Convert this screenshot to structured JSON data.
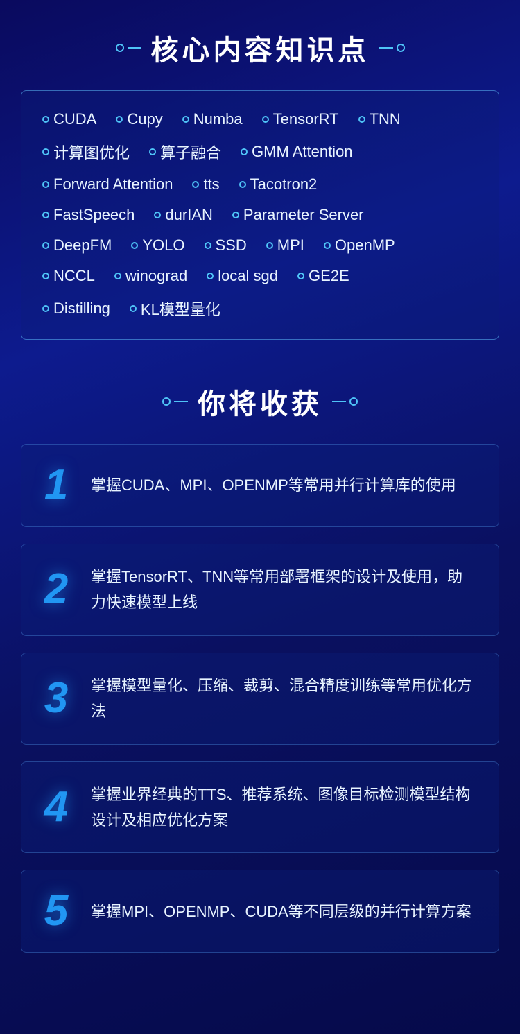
{
  "section1": {
    "title": "核心内容知识点",
    "keywords_rows": [
      [
        "CUDA",
        "Cupy",
        "Numba",
        "TensorRT",
        "TNN"
      ],
      [
        "计算图优化",
        "算子融合",
        "GMM Attention"
      ],
      [
        "Forward Attention",
        "tts",
        "Tacotron2"
      ],
      [
        "FastSpeech",
        "durIAN",
        "Parameter Server"
      ],
      [
        "DeepFM",
        "YOLO",
        "SSD",
        "MPI",
        "OpenMP"
      ],
      [
        "NCCL",
        "winograd",
        "local sgd",
        "GE2E"
      ],
      [
        "Distilling",
        "KL模型量化"
      ]
    ]
  },
  "section2": {
    "title": "你将收获",
    "benefits": [
      {
        "number": "1",
        "text": "掌握CUDA、MPI、OPENMP等常用并行计算库的使用"
      },
      {
        "number": "2",
        "text": "掌握TensorRT、TNN等常用部署框架的设计及使用，助力快速模型上线"
      },
      {
        "number": "3",
        "text": "掌握模型量化、压缩、裁剪、混合精度训练等常用优化方法"
      },
      {
        "number": "4",
        "text": "掌握业界经典的TTS、推荐系统、图像目标检测模型结构设计及相应优化方案"
      },
      {
        "number": "5",
        "text": "掌握MPI、OPENMP、CUDA等不同层级的并行计算方案"
      }
    ]
  },
  "ornament": {
    "left": "◇",
    "right": "◇"
  }
}
